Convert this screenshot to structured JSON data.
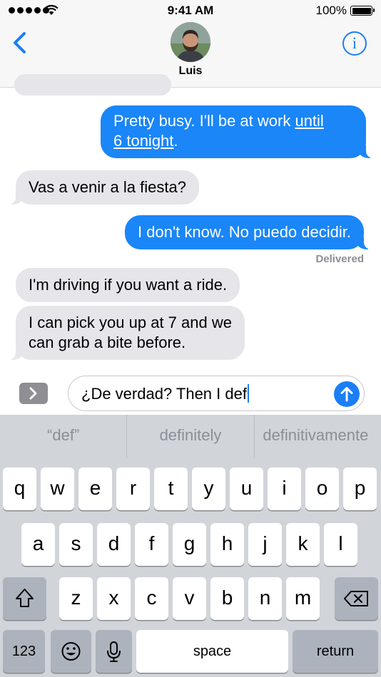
{
  "status_bar": {
    "time": "9:41 AM",
    "battery_percent": "100%"
  },
  "header": {
    "contact_name": "Luis",
    "info_label": "i"
  },
  "transcript": {
    "messages": [
      {
        "direction": "outgoing",
        "parts": [
          "Pretty busy. I'll be at work ",
          "until",
          "6 tonight",
          "."
        ]
      },
      {
        "direction": "incoming",
        "text": "Vas a venir a la fiesta?"
      },
      {
        "direction": "outgoing",
        "text": "I don't know. No puedo decidir."
      },
      {
        "direction": "incoming",
        "text": "I'm driving if you want a ride."
      },
      {
        "direction": "incoming",
        "lines": [
          "I can pick you up at 7 and we",
          "can grab a bite before."
        ]
      }
    ],
    "delivered_label": "Delivered"
  },
  "composer": {
    "text": "¿De verdad? Then I def"
  },
  "keyboard": {
    "predictions": [
      "“def”",
      "definitely",
      "definitivamente"
    ],
    "row1": [
      "q",
      "w",
      "e",
      "r",
      "t",
      "y",
      "u",
      "i",
      "o",
      "p"
    ],
    "row2": [
      "a",
      "s",
      "d",
      "f",
      "g",
      "h",
      "j",
      "k",
      "l"
    ],
    "row3": [
      "z",
      "x",
      "c",
      "v",
      "b",
      "n",
      "m"
    ],
    "numbers_label": "123",
    "space_label": "space",
    "return_label": "return"
  },
  "colors": {
    "accent": "#1a7ef5",
    "outgoing_bubble": "#1a86f7",
    "incoming_bubble": "#e5e5ea",
    "keyboard_bg": "#d1d4d9"
  },
  "icons": [
    "wifi-icon",
    "back-chevron-icon",
    "info-icon",
    "app-drawer-chevron-icon",
    "send-arrow-icon",
    "shift-icon",
    "delete-icon",
    "emoji-icon",
    "microphone-icon"
  ]
}
